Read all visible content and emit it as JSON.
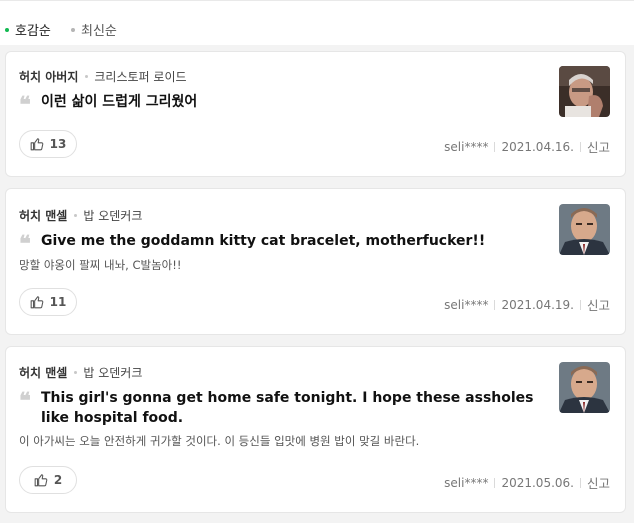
{
  "sort": {
    "active": "호감순",
    "inactive": "최신순"
  },
  "reviews": [
    {
      "character": "허치 아버지",
      "actor": "크리스토퍼 로이드",
      "quote": "이런 삶이 드럽게 그리웠어",
      "translation": "",
      "likes": "13",
      "user": "seli****",
      "date": "2021.04.16.",
      "report": "신고",
      "avatar": "old-man-photo"
    },
    {
      "character": "허치 맨셀",
      "actor": "밥 오덴커크",
      "quote": "Give me the goddamn kitty cat bracelet, motherfucker!!",
      "translation": "망할 야옹이 팔찌 내놔, C발놈아!!",
      "likes": "11",
      "user": "seli****",
      "date": "2021.04.19.",
      "report": "신고",
      "avatar": "man-in-suit-photo"
    },
    {
      "character": "허치 맨셀",
      "actor": "밥 오덴커크",
      "quote": "This girl's gonna get home safe tonight. I hope these assholes like hospital food.",
      "translation": "이 아가씨는 오늘 안전하게 귀가할 것이다. 이 등신들 입맛에 병원 밥이 맞길 바란다.",
      "likes": "2",
      "user": "seli****",
      "date": "2021.05.06.",
      "report": "신고",
      "avatar": "man-in-suit-photo"
    }
  ],
  "icons": {
    "like": "thumbs-up-icon",
    "quote": "quote-mark-icon"
  },
  "colors": {
    "active_dot": "#12b951",
    "inactive_dot": "#b5b5b5"
  }
}
